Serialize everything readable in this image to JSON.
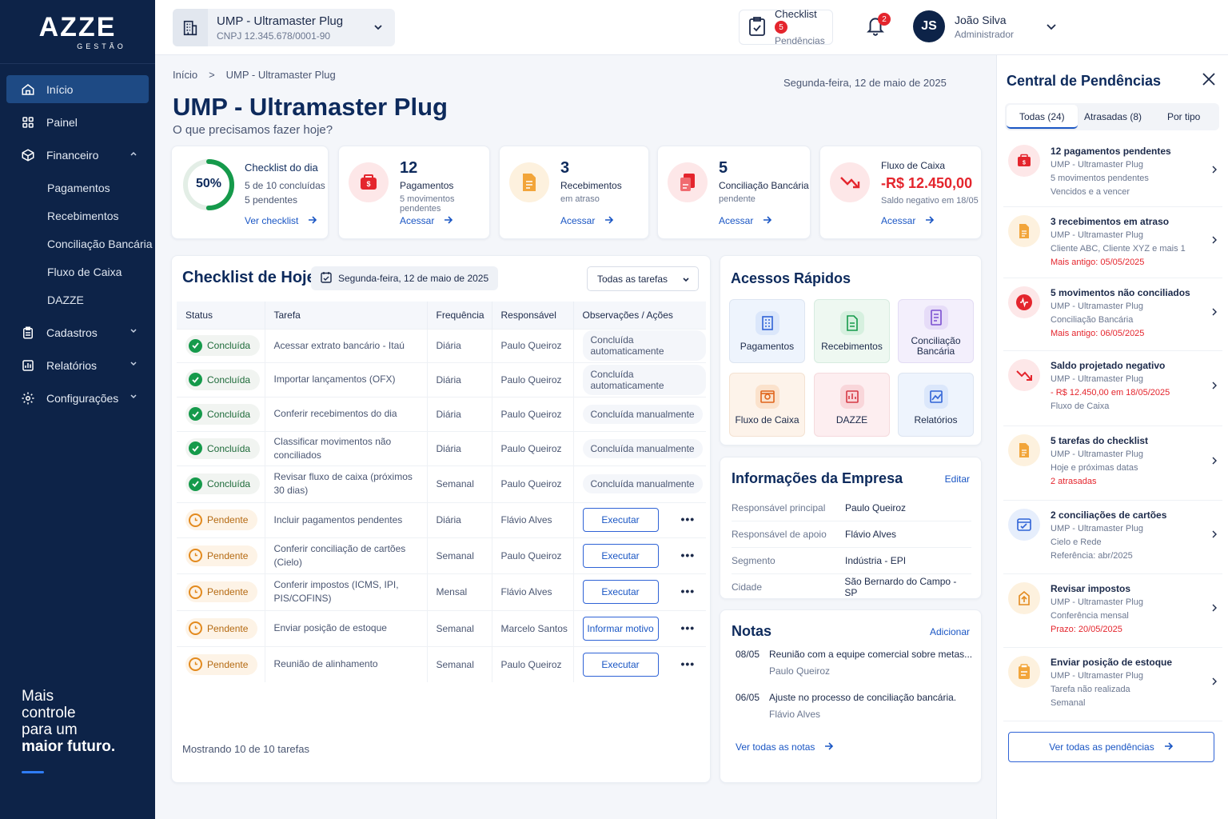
{
  "brand": {
    "logo": "AZZE",
    "logo_sub": "GESTÃO"
  },
  "sidebar": {
    "items": [
      {
        "label": "Início",
        "icon": "home-icon"
      },
      {
        "label": "Painel",
        "icon": "grid-icon"
      },
      {
        "label": "Financeiro",
        "icon": "cube-icon"
      },
      {
        "label": "Cadastros",
        "icon": "clipboard-icon"
      },
      {
        "label": "Relatórios",
        "icon": "chart-icon"
      },
      {
        "label": "Configurações",
        "icon": "gear-icon"
      }
    ],
    "financeiro_sub": [
      "Pagamentos",
      "Recebimentos",
      "Conciliação Bancária",
      "Fluxo de Caixa",
      "DAZZE"
    ],
    "slogan": [
      "Mais",
      "controle",
      "para um",
      "maior futuro."
    ]
  },
  "topbar": {
    "company_name": "UMP - Ultramaster Plug",
    "company_cnpj": "CNPJ 12.345.678/0001-90",
    "checklist_label": "Checklist",
    "checklist_sub": "Pendências",
    "checklist_badge": "5",
    "notif_badge": "2",
    "user_initials": "JS",
    "user_name": "João Silva",
    "user_role": "Administrador"
  },
  "page": {
    "breadcrumb": [
      "Início",
      "UMP - Ultramaster Plug"
    ],
    "breadcrumb_sep": ">",
    "date": "Segunda-feira, 12 de maio de 2025",
    "title": "UMP - Ultramaster Plug",
    "subtitle": "O que precisamos fazer hoje?"
  },
  "kpis": {
    "checklist": {
      "percent": "50%",
      "progress": 0.5,
      "title": "Checklist do dia",
      "line1": "5 de 10 concluídas",
      "line2": "5 pendentes",
      "link": "Ver checklist"
    },
    "pagamentos": {
      "num": "12",
      "label": "Pagamentos",
      "sub": "5 movimentos pendentes",
      "link": "Acessar"
    },
    "recebimentos": {
      "num": "3",
      "label": "Recebimentos",
      "sub": "em atraso",
      "link": "Acessar"
    },
    "conciliacao": {
      "num": "5",
      "label": "Conciliação Bancária",
      "sub": "pendente",
      "link": "Acessar"
    },
    "fluxo": {
      "label": "Fluxo de Caixa",
      "value": "-R$ 12.450,00",
      "sub": "Saldo negativo em 18/05",
      "link": "Acessar"
    }
  },
  "checklist": {
    "title": "Checklist de Hoje",
    "date": "Segunda-feira, 12 de maio de 2025",
    "filter": "Todas as tarefas",
    "columns": [
      "Status",
      "Tarefa",
      "Frequência",
      "Responsável",
      "Observações / Ações"
    ],
    "rows": [
      {
        "status": "Concluída",
        "task": "Acessar extrato bancário - Itaú",
        "freq": "Diária",
        "resp": "Paulo Queiroz",
        "obs": "Concluída automaticamente"
      },
      {
        "status": "Concluída",
        "task": "Importar lançamentos (OFX)",
        "freq": "Diária",
        "resp": "Paulo Queiroz",
        "obs": "Concluída automaticamente"
      },
      {
        "status": "Concluída",
        "task": "Conferir recebimentos do dia",
        "freq": "Diária",
        "resp": "Paulo Queiroz",
        "obs": "Concluída manualmente"
      },
      {
        "status": "Concluída",
        "task": "Classificar movimentos não conciliados",
        "freq": "Diária",
        "resp": "Paulo Queiroz",
        "obs": "Concluída manualmente"
      },
      {
        "status": "Concluída",
        "task": "Revisar fluxo de caixa (próximos 30 dias)",
        "freq": "Semanal",
        "resp": "Paulo Queiroz",
        "obs": "Concluída manualmente"
      },
      {
        "status": "Pendente",
        "task": "Incluir pagamentos pendentes",
        "freq": "Diária",
        "resp": "Flávio Alves",
        "action": "Executar"
      },
      {
        "status": "Pendente",
        "task": "Conferir conciliação de cartões (Cielo)",
        "freq": "Semanal",
        "resp": "Paulo Queiroz",
        "action": "Executar"
      },
      {
        "status": "Pendente",
        "task": "Conferir impostos (ICMS, IPI, PIS/COFINS)",
        "freq": "Mensal",
        "resp": "Flávio Alves",
        "action": "Executar"
      },
      {
        "status": "Pendente",
        "task": "Enviar posição de estoque",
        "freq": "Semanal",
        "resp": "Marcelo Santos",
        "action": "Informar motivo"
      },
      {
        "status": "Pendente",
        "task": "Reunião de alinhamento",
        "freq": "Semanal",
        "resp": "Paulo Queiroz",
        "action": "Executar"
      }
    ],
    "showing": "Mostrando 10 de 10 tarefas"
  },
  "quick": {
    "title": "Acessos Rápidos",
    "tiles": [
      "Pagamentos",
      "Recebimentos",
      "Conciliação Bancária",
      "Fluxo de Caixa",
      "DAZZE",
      "Relatórios"
    ]
  },
  "info": {
    "title": "Informações da Empresa",
    "edit": "Editar",
    "rows": [
      {
        "k": "Responsável principal",
        "v": "Paulo Queiroz"
      },
      {
        "k": "Responsável de apoio",
        "v": "Flávio Alves"
      },
      {
        "k": "Segmento",
        "v": "Indústria - EPI"
      },
      {
        "k": "Cidade",
        "v": "São Bernardo do Campo - SP"
      }
    ]
  },
  "notes": {
    "title": "Notas",
    "add": "Adicionar",
    "items": [
      {
        "date": "08/05",
        "text": "Reunião com a equipe comercial sobre metas...",
        "author": "Paulo Queiroz"
      },
      {
        "date": "06/05",
        "text": "Ajuste no processo de conciliação bancária.",
        "author": "Flávio Alves"
      }
    ],
    "link": "Ver todas as notas"
  },
  "pending_panel": {
    "title": "Central de Pendências",
    "tabs": [
      "Todas (24)",
      "Atrasadas (8)",
      "Por tipo"
    ],
    "items": [
      {
        "title": "12 pagamentos pendentes",
        "lines": [
          "UMP - Ultramaster Plug",
          "5 movimentos pendentes",
          "Vencidos e a vencer"
        ],
        "red": ""
      },
      {
        "title": "3 recebimentos em atraso",
        "lines": [
          "UMP - Ultramaster Plug",
          "Cliente ABC, Cliente XYZ e mais 1"
        ],
        "red": "Mais antigo: 05/05/2025"
      },
      {
        "title": "5 movimentos não conciliados",
        "lines": [
          "UMP - Ultramaster Plug",
          "Conciliação Bancária"
        ],
        "red": "Mais antigo: 06/05/2025"
      },
      {
        "title": "Saldo projetado negativo",
        "lines": [
          "UMP - Ultramaster Plug"
        ],
        "red": "- R$ 12.450,00 em 18/05/2025",
        "after": "Fluxo de Caixa"
      },
      {
        "title": "5 tarefas do checklist",
        "lines": [
          "UMP - Ultramaster Plug",
          "Hoje e próximas datas"
        ],
        "red": "2 atrasadas"
      },
      {
        "title": "2 conciliações de cartões",
        "lines": [
          "UMP - Ultramaster Plug",
          "Cielo e Rede",
          "Referência: abr/2025"
        ],
        "red": ""
      },
      {
        "title": "Revisar impostos",
        "lines": [
          "UMP - Ultramaster Plug",
          "Conferência mensal"
        ],
        "red": "Prazo: 20/05/2025"
      },
      {
        "title": "Enviar posição de estoque",
        "lines": [
          "UMP - Ultramaster Plug",
          "Tarefa não realizada",
          "Semanal"
        ],
        "red": ""
      }
    ],
    "all_link": "Ver todas as pendências"
  },
  "colors": {
    "navy": "#0d2348",
    "accent": "#1a56c4",
    "green": "#159a4b",
    "orange": "#e38a1e",
    "red": "#e4252d"
  }
}
